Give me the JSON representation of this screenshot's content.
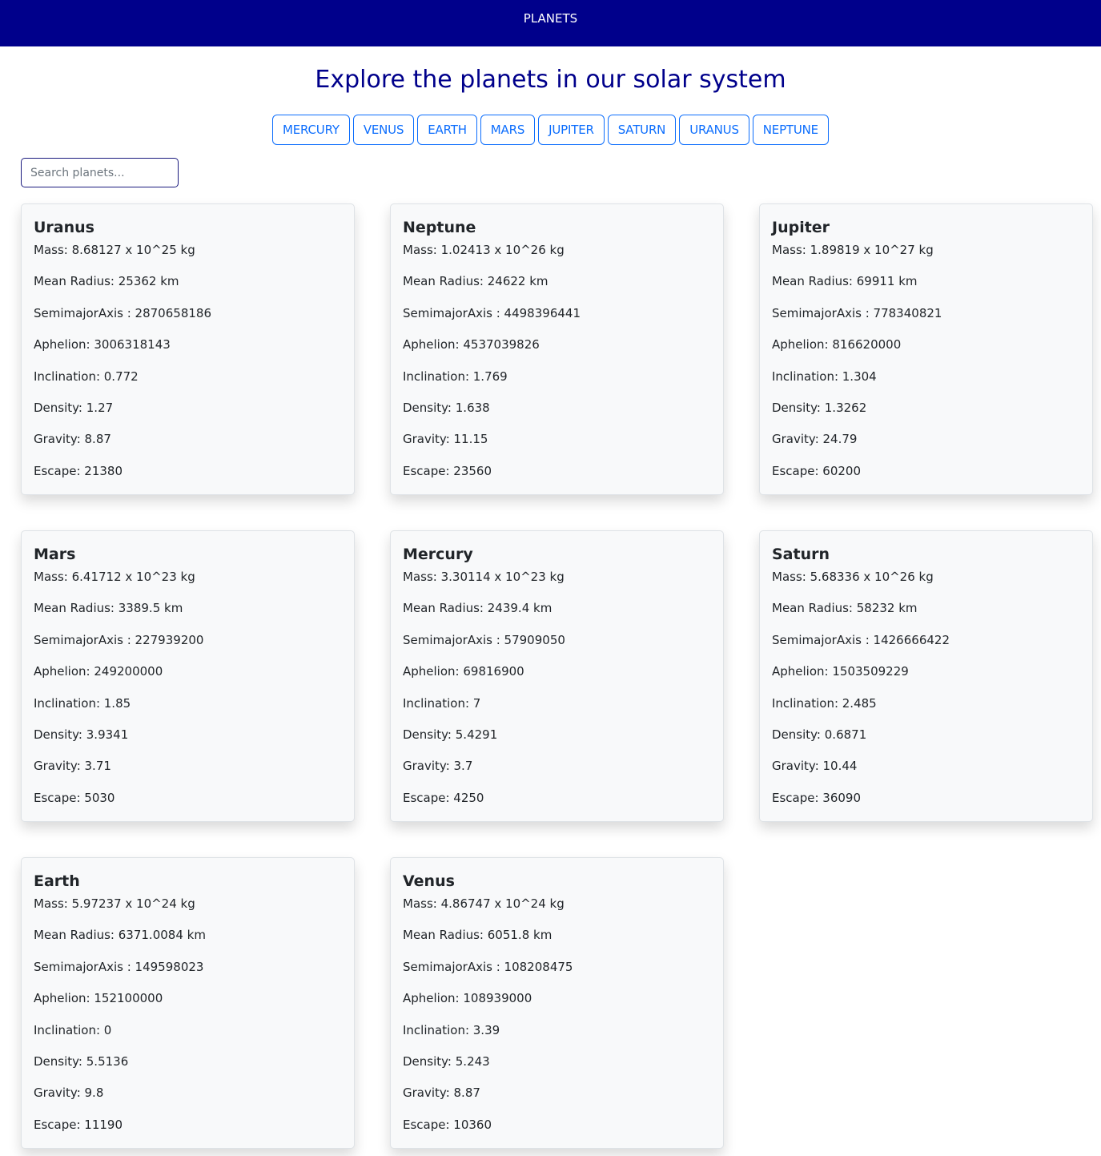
{
  "navbar": {
    "brand": "PLANETS"
  },
  "header": {
    "title": "Explore the planets in our solar system"
  },
  "filters": [
    "MERCURY",
    "VENUS",
    "EARTH",
    "MARS",
    "JUPITER",
    "SATURN",
    "URANUS",
    "NEPTUNE"
  ],
  "search": {
    "placeholder": "Search planets...",
    "value": ""
  },
  "planets": [
    {
      "name": "Uranus",
      "mass": "Mass: 8.68127 x 10^25 kg",
      "radius": "Mean Radius: 25362 km",
      "axis": "SemimajorAxis : 2870658186",
      "aphelion": "Aphelion: 3006318143",
      "inclination": "Inclination: 0.772",
      "density": "Density: 1.27",
      "gravity": "Gravity: 8.87",
      "escape": "Escape: 21380"
    },
    {
      "name": "Neptune",
      "mass": "Mass: 1.02413 x 10^26 kg",
      "radius": "Mean Radius: 24622 km",
      "axis": "SemimajorAxis : 4498396441",
      "aphelion": "Aphelion: 4537039826",
      "inclination": "Inclination: 1.769",
      "density": "Density: 1.638",
      "gravity": "Gravity: 11.15",
      "escape": "Escape: 23560"
    },
    {
      "name": "Jupiter",
      "mass": "Mass: 1.89819 x 10^27 kg",
      "radius": "Mean Radius: 69911 km",
      "axis": "SemimajorAxis : 778340821",
      "aphelion": "Aphelion: 816620000",
      "inclination": "Inclination: 1.304",
      "density": "Density: 1.3262",
      "gravity": "Gravity: 24.79",
      "escape": "Escape: 60200"
    },
    {
      "name": "Mars",
      "mass": "Mass: 6.41712 x 10^23 kg",
      "radius": "Mean Radius: 3389.5 km",
      "axis": "SemimajorAxis : 227939200",
      "aphelion": "Aphelion: 249200000",
      "inclination": "Inclination: 1.85",
      "density": "Density: 3.9341",
      "gravity": "Gravity: 3.71",
      "escape": "Escape: 5030"
    },
    {
      "name": "Mercury",
      "mass": "Mass: 3.30114 x 10^23 kg",
      "radius": "Mean Radius: 2439.4 km",
      "axis": "SemimajorAxis : 57909050",
      "aphelion": "Aphelion: 69816900",
      "inclination": "Inclination: 7",
      "density": "Density: 5.4291",
      "gravity": "Gravity: 3.7",
      "escape": "Escape: 4250"
    },
    {
      "name": "Saturn",
      "mass": "Mass: 5.68336 x 10^26 kg",
      "radius": "Mean Radius: 58232 km",
      "axis": "SemimajorAxis : 1426666422",
      "aphelion": "Aphelion: 1503509229",
      "inclination": "Inclination: 2.485",
      "density": "Density: 0.6871",
      "gravity": "Gravity: 10.44",
      "escape": "Escape: 36090"
    },
    {
      "name": "Earth",
      "mass": "Mass: 5.97237 x 10^24 kg",
      "radius": "Mean Radius: 6371.0084 km",
      "axis": "SemimajorAxis : 149598023",
      "aphelion": "Aphelion: 152100000",
      "inclination": "Inclination: 0",
      "density": "Density: 5.5136",
      "gravity": "Gravity: 9.8",
      "escape": "Escape: 11190"
    },
    {
      "name": "Venus",
      "mass": "Mass: 4.86747 x 10^24 kg",
      "radius": "Mean Radius: 6051.8 km",
      "axis": "SemimajorAxis : 108208475",
      "aphelion": "Aphelion: 108939000",
      "inclination": "Inclination: 3.39",
      "density": "Density: 5.243",
      "gravity": "Gravity: 8.87",
      "escape": "Escape: 10360"
    }
  ]
}
